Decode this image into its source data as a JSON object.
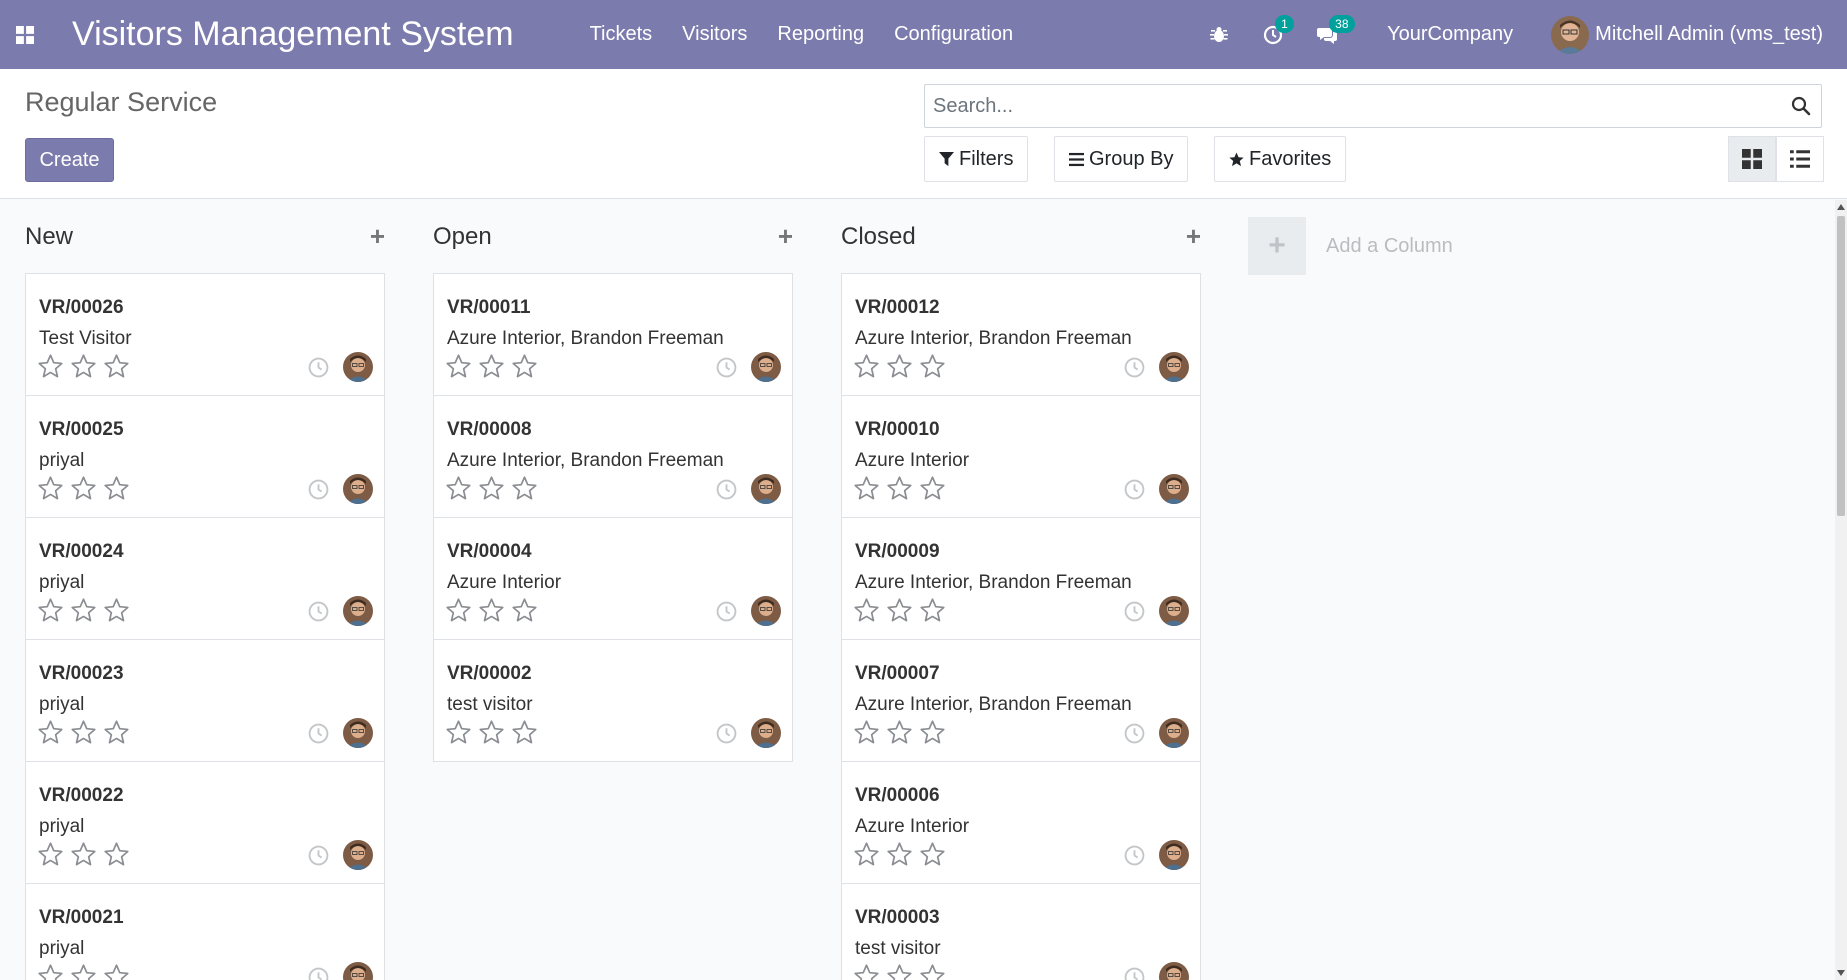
{
  "navbar": {
    "brand": "Visitors Management System",
    "menu": [
      "Tickets",
      "Visitors",
      "Reporting",
      "Configuration"
    ],
    "activities_count": "1",
    "messages_count": "38",
    "company": "YourCompany",
    "user": "Mitchell Admin (vms_test)"
  },
  "control_panel": {
    "breadcrumb": "Regular Service",
    "create_label": "Create",
    "search_placeholder": "Search...",
    "filters_label": "Filters",
    "groupby_label": "Group By",
    "favorites_label": "Favorites"
  },
  "kanban": {
    "add_column_label": "Add a Column",
    "columns": [
      {
        "title": "New",
        "cards": [
          {
            "ref": "VR/00026",
            "name": "Test Visitor"
          },
          {
            "ref": "VR/00025",
            "name": "priyal"
          },
          {
            "ref": "VR/00024",
            "name": "priyal"
          },
          {
            "ref": "VR/00023",
            "name": "priyal"
          },
          {
            "ref": "VR/00022",
            "name": "priyal"
          },
          {
            "ref": "VR/00021",
            "name": "priyal"
          }
        ]
      },
      {
        "title": "Open",
        "cards": [
          {
            "ref": "VR/00011",
            "name": "Azure Interior, Brandon Freeman"
          },
          {
            "ref": "VR/00008",
            "name": "Azure Interior, Brandon Freeman"
          },
          {
            "ref": "VR/00004",
            "name": "Azure Interior"
          },
          {
            "ref": "VR/00002",
            "name": "test visitor"
          }
        ]
      },
      {
        "title": "Closed",
        "cards": [
          {
            "ref": "VR/00012",
            "name": "Azure Interior, Brandon Freeman"
          },
          {
            "ref": "VR/00010",
            "name": "Azure Interior"
          },
          {
            "ref": "VR/00009",
            "name": "Azure Interior, Brandon Freeman"
          },
          {
            "ref": "VR/00007",
            "name": "Azure Interior, Brandon Freeman"
          },
          {
            "ref": "VR/00006",
            "name": "Azure Interior"
          },
          {
            "ref": "VR/00003",
            "name": "test visitor"
          }
        ]
      }
    ]
  },
  "colors": {
    "navbar": "#7c7bad",
    "badge": "#00a09d",
    "primary_button": "#7c7bad"
  },
  "icons": {
    "apps": "apps-grid-icon",
    "debug": "bug-icon",
    "activities": "clock-icon",
    "messages": "chat-bubbles-icon",
    "search": "magnifier-icon",
    "filters": "filter-funnel-icon",
    "groupby": "bars-icon",
    "favorites": "star-icon",
    "kanban_view": "kanban-grid-icon",
    "list_view": "list-icon",
    "priority": "star-outline-icon",
    "activity": "clock-outline-icon"
  }
}
